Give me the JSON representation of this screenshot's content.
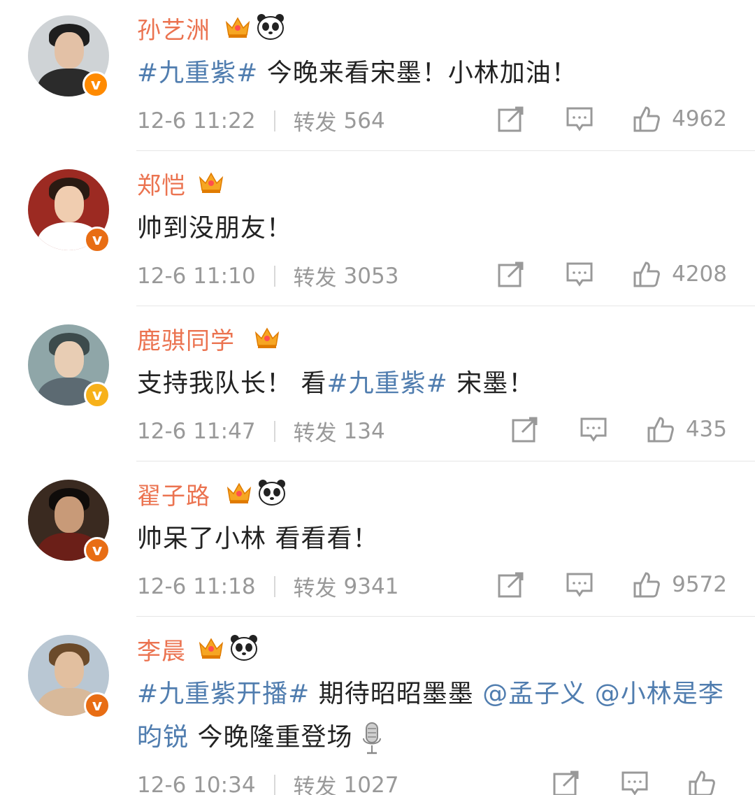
{
  "posts": [
    {
      "username": "孙艺洲",
      "badges": [
        "crown-icon",
        "panda-icon"
      ],
      "content": [
        {
          "type": "topic",
          "text": "#九重紫#"
        },
        {
          "type": "text",
          "text": " 今晚来看宋墨！小林加油！"
        }
      ],
      "time": "12-6 11:22",
      "repost_label": "转发",
      "repost_count": "564",
      "like_count": "4962",
      "verified_color": "#ff8a00"
    },
    {
      "username": "郑恺",
      "badges": [
        "crown-icon"
      ],
      "content": [
        {
          "type": "text",
          "text": "帅到没朋友！"
        }
      ],
      "time": "12-6 11:10",
      "repost_label": "转发",
      "repost_count": "3053",
      "like_count": "4208",
      "verified_color": "#e86d14"
    },
    {
      "username": "鹿骐同学",
      "badges": [
        "crown-icon"
      ],
      "content": [
        {
          "type": "text",
          "text": "支持我队长！ 看"
        },
        {
          "type": "topic",
          "text": "#九重紫#"
        },
        {
          "type": "text",
          "text": " 宋墨！"
        }
      ],
      "time": "12-6 11:47",
      "repost_label": "转发",
      "repost_count": "134",
      "like_count": "435",
      "verified_color": "#f7b11a"
    },
    {
      "username": "翟子路",
      "badges": [
        "crown-icon",
        "panda-icon"
      ],
      "content": [
        {
          "type": "text",
          "text": "帅呆了小林 看看看！"
        }
      ],
      "time": "12-6 11:18",
      "repost_label": "转发",
      "repost_count": "9341",
      "like_count": "9572",
      "verified_color": "#e86d14"
    },
    {
      "username": "李晨",
      "badges": [
        "crown-icon",
        "panda-icon"
      ],
      "content": [
        {
          "type": "topic",
          "text": "#九重紫开播#"
        },
        {
          "type": "text",
          "text": " 期待昭昭墨墨 "
        },
        {
          "type": "mention",
          "text": "@孟子义"
        },
        {
          "type": "text",
          "text": " "
        },
        {
          "type": "mention",
          "text": "@小林是李昀锐"
        },
        {
          "type": "text",
          "text": " 今晚隆重登场"
        }
      ],
      "trailing_icon": "microphone-icon",
      "time": "12-6 10:34",
      "repost_label": "转发",
      "repost_count": "1027",
      "like_count": "",
      "verified_color": "#e86d14"
    }
  ],
  "colors": {
    "username": "#eb7350",
    "topic_link": "#507daf",
    "meta_gray": "#999999",
    "divider": "#e6e6e6"
  }
}
